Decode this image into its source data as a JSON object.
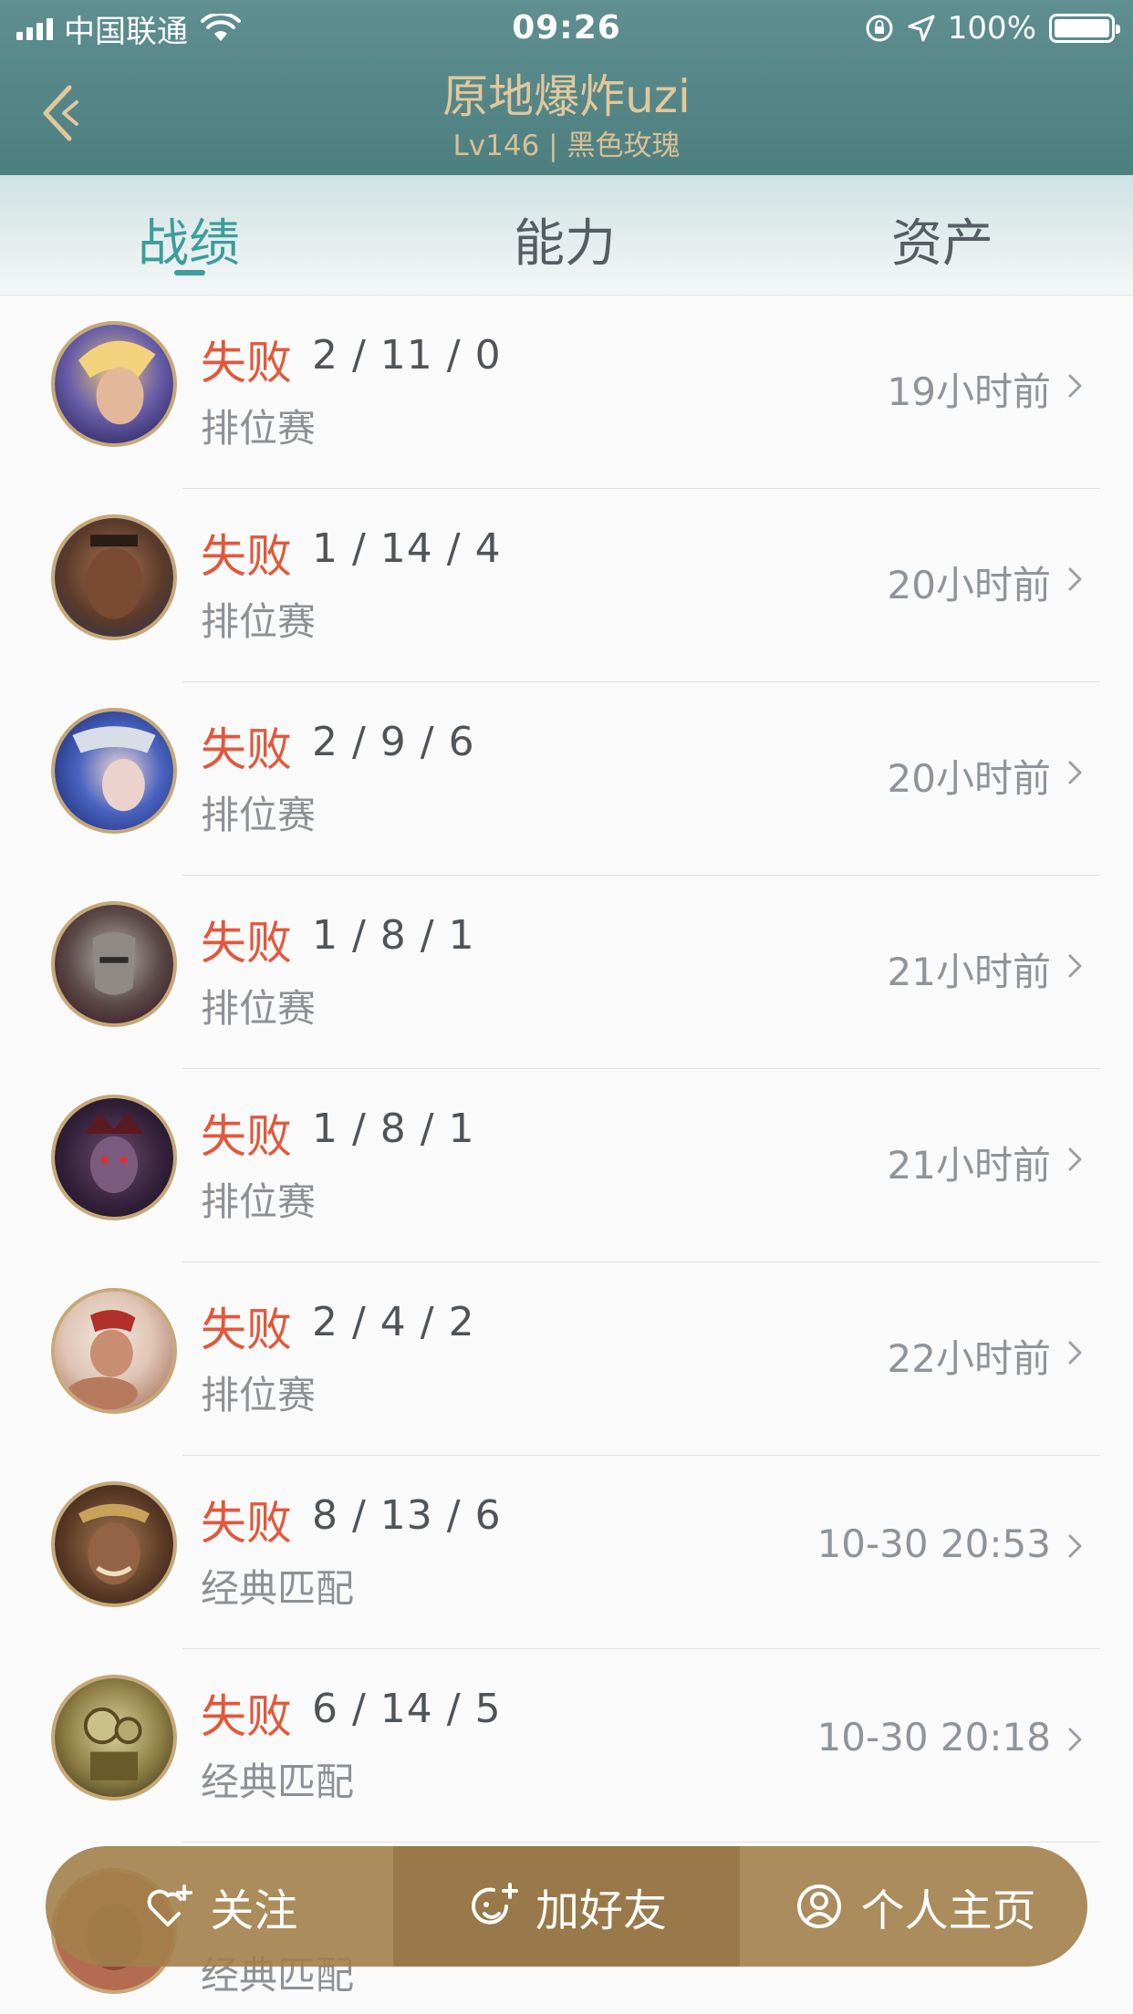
{
  "status_bar": {
    "carrier": "中国联通",
    "time": "09:26",
    "battery_text": "100%"
  },
  "nav": {
    "title": "原地爆炸uzi",
    "subtitle": "Lv146 | 黑色玫瑰"
  },
  "tabs": [
    {
      "label": "战绩"
    },
    {
      "label": "能力"
    },
    {
      "label": "资产"
    }
  ],
  "matches": [
    {
      "result": "失败",
      "kda": "2 / 11 / 0",
      "mode": "排位赛",
      "time": "19小时前"
    },
    {
      "result": "失败",
      "kda": "1 / 14 / 4",
      "mode": "排位赛",
      "time": "20小时前"
    },
    {
      "result": "失败",
      "kda": "2 / 9 / 6",
      "mode": "排位赛",
      "time": "20小时前"
    },
    {
      "result": "失败",
      "kda": "1 / 8 / 1",
      "mode": "排位赛",
      "time": "21小时前"
    },
    {
      "result": "失败",
      "kda": "1 / 8 / 1",
      "mode": "排位赛",
      "time": "21小时前"
    },
    {
      "result": "失败",
      "kda": "2 / 4 / 2",
      "mode": "排位赛",
      "time": "22小时前"
    },
    {
      "result": "失败",
      "kda": "8 / 13 / 6",
      "mode": "经典匹配",
      "time": "10-30 20:53"
    },
    {
      "result": "失败",
      "kda": "6 / 14 / 5",
      "mode": "经典匹配",
      "time": "10-30 20:18"
    },
    {
      "result": "",
      "kda": "",
      "mode": "经典匹配",
      "time": ""
    }
  ],
  "actions": {
    "follow": "关注",
    "add_friend": "加好友",
    "profile": "个人主页"
  },
  "colors": {
    "header": "#5a8a8b",
    "accent": "#3d9d9b",
    "loss": "#e3573a",
    "gold": "#e1c79b",
    "action_bar": "#a2804a"
  }
}
